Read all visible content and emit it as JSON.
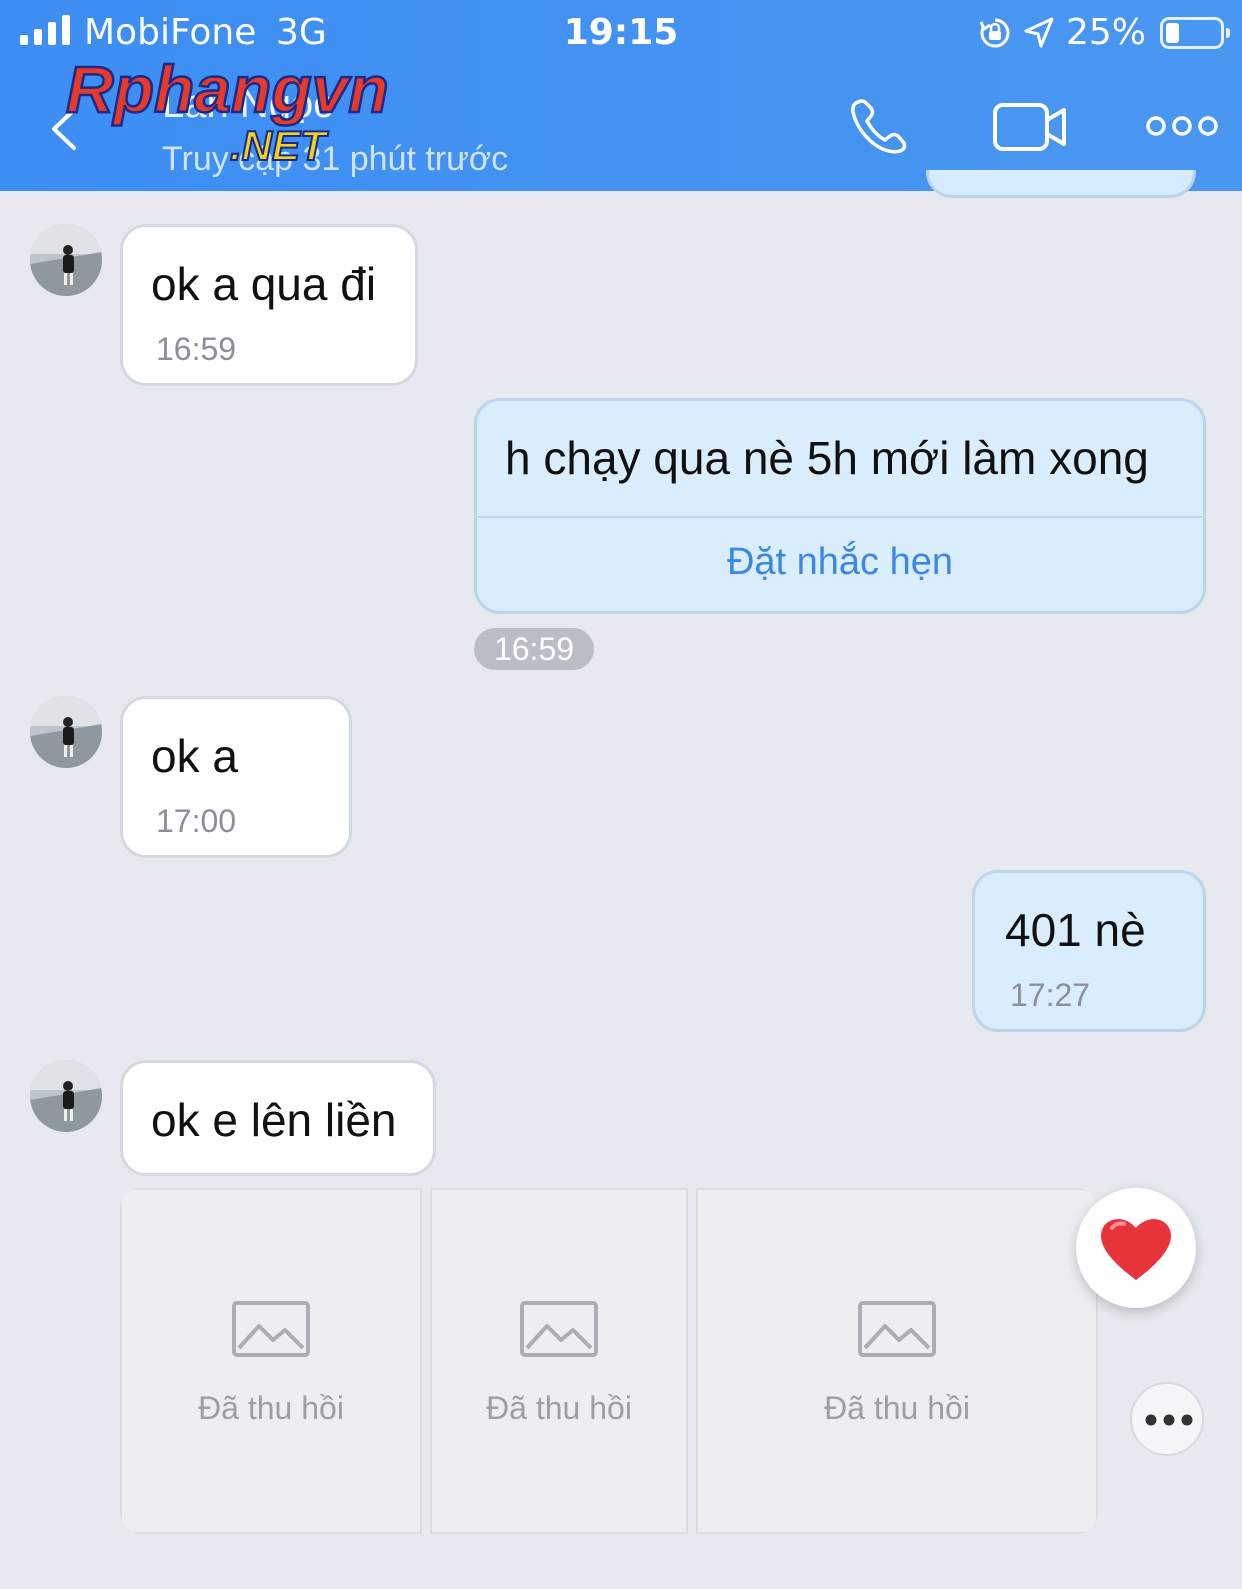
{
  "status_bar": {
    "carrier": "MobiFone",
    "network": "3G",
    "time": "19:15",
    "battery_percent": "25%",
    "battery_level": 0.25
  },
  "header": {
    "contact_name": "Lan Ngọc",
    "contact_status": "Truy cập 31 phút trước",
    "watermark": "Rphangvn .NET"
  },
  "messages": [
    {
      "direction": "in",
      "text": "ok a qua đi",
      "time": "16:59"
    },
    {
      "direction": "out",
      "text": "h chạy qua nè 5h mới làm xong",
      "action": "Đặt nhắc hẹn",
      "time": "16:59"
    },
    {
      "direction": "in",
      "text": "ok a",
      "time": "17:00"
    },
    {
      "direction": "out",
      "text": "401 nè",
      "time": "17:27"
    },
    {
      "direction": "in",
      "text": "ok e lên liền"
    }
  ],
  "recalled_images": [
    {
      "label": "Đã thu hồi"
    },
    {
      "label": "Đã thu hồi"
    },
    {
      "label": "Đã thu hồi"
    }
  ],
  "colors": {
    "header": "#4493f2",
    "background": "#e6e9ef",
    "outgoing_bubble": "#d9edfd",
    "link": "#3c87e6",
    "heart": "#e8333b"
  }
}
